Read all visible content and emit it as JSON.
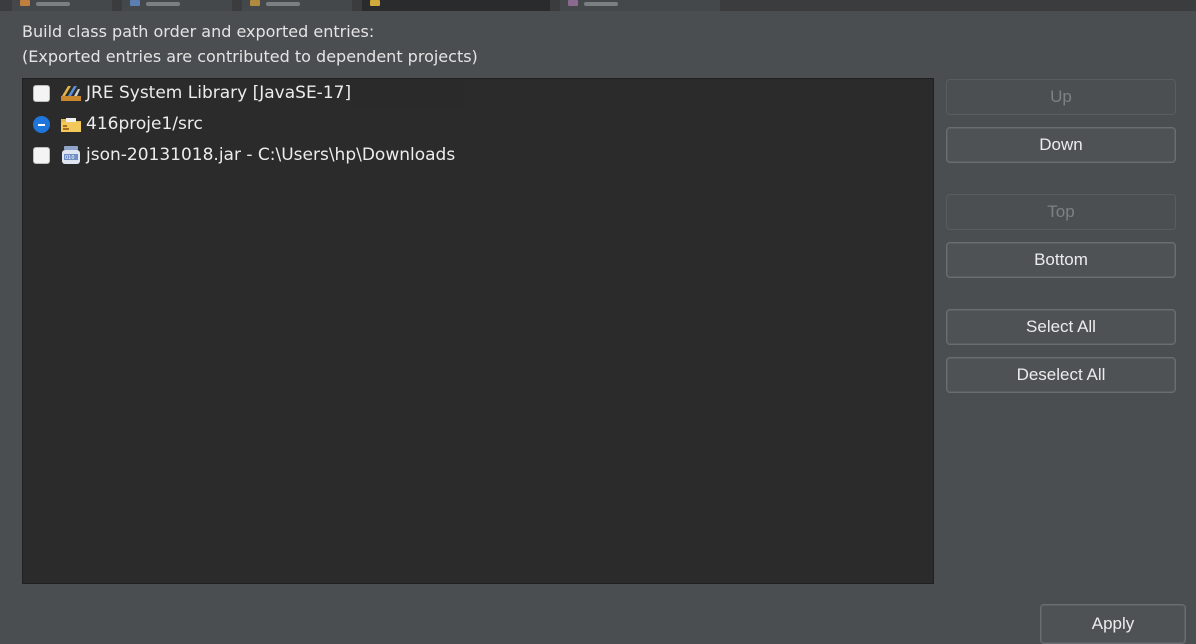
{
  "description": {
    "line1": "Build class path order and exported entries:",
    "line2": "(Exported entries are contributed to dependent projects)"
  },
  "entries": [
    {
      "label": "JRE System Library [JavaSE-17]",
      "state": "unchecked",
      "icon": "library-icon"
    },
    {
      "label": "416proje1/src",
      "state": "mixed",
      "icon": "source-folder-icon"
    },
    {
      "label": "json-20131018.jar - C:\\Users\\hp\\Downloads",
      "state": "unchecked",
      "icon": "jar-icon"
    }
  ],
  "buttons": {
    "up": "Up",
    "down": "Down",
    "top": "Top",
    "bottom": "Bottom",
    "select_all": "Select All",
    "deselect_all": "Deselect All",
    "apply": "Apply"
  },
  "colors": {
    "background": "#4b4e51",
    "list_background": "#2b2b2b",
    "checkbox_accent": "#1f75d9"
  }
}
